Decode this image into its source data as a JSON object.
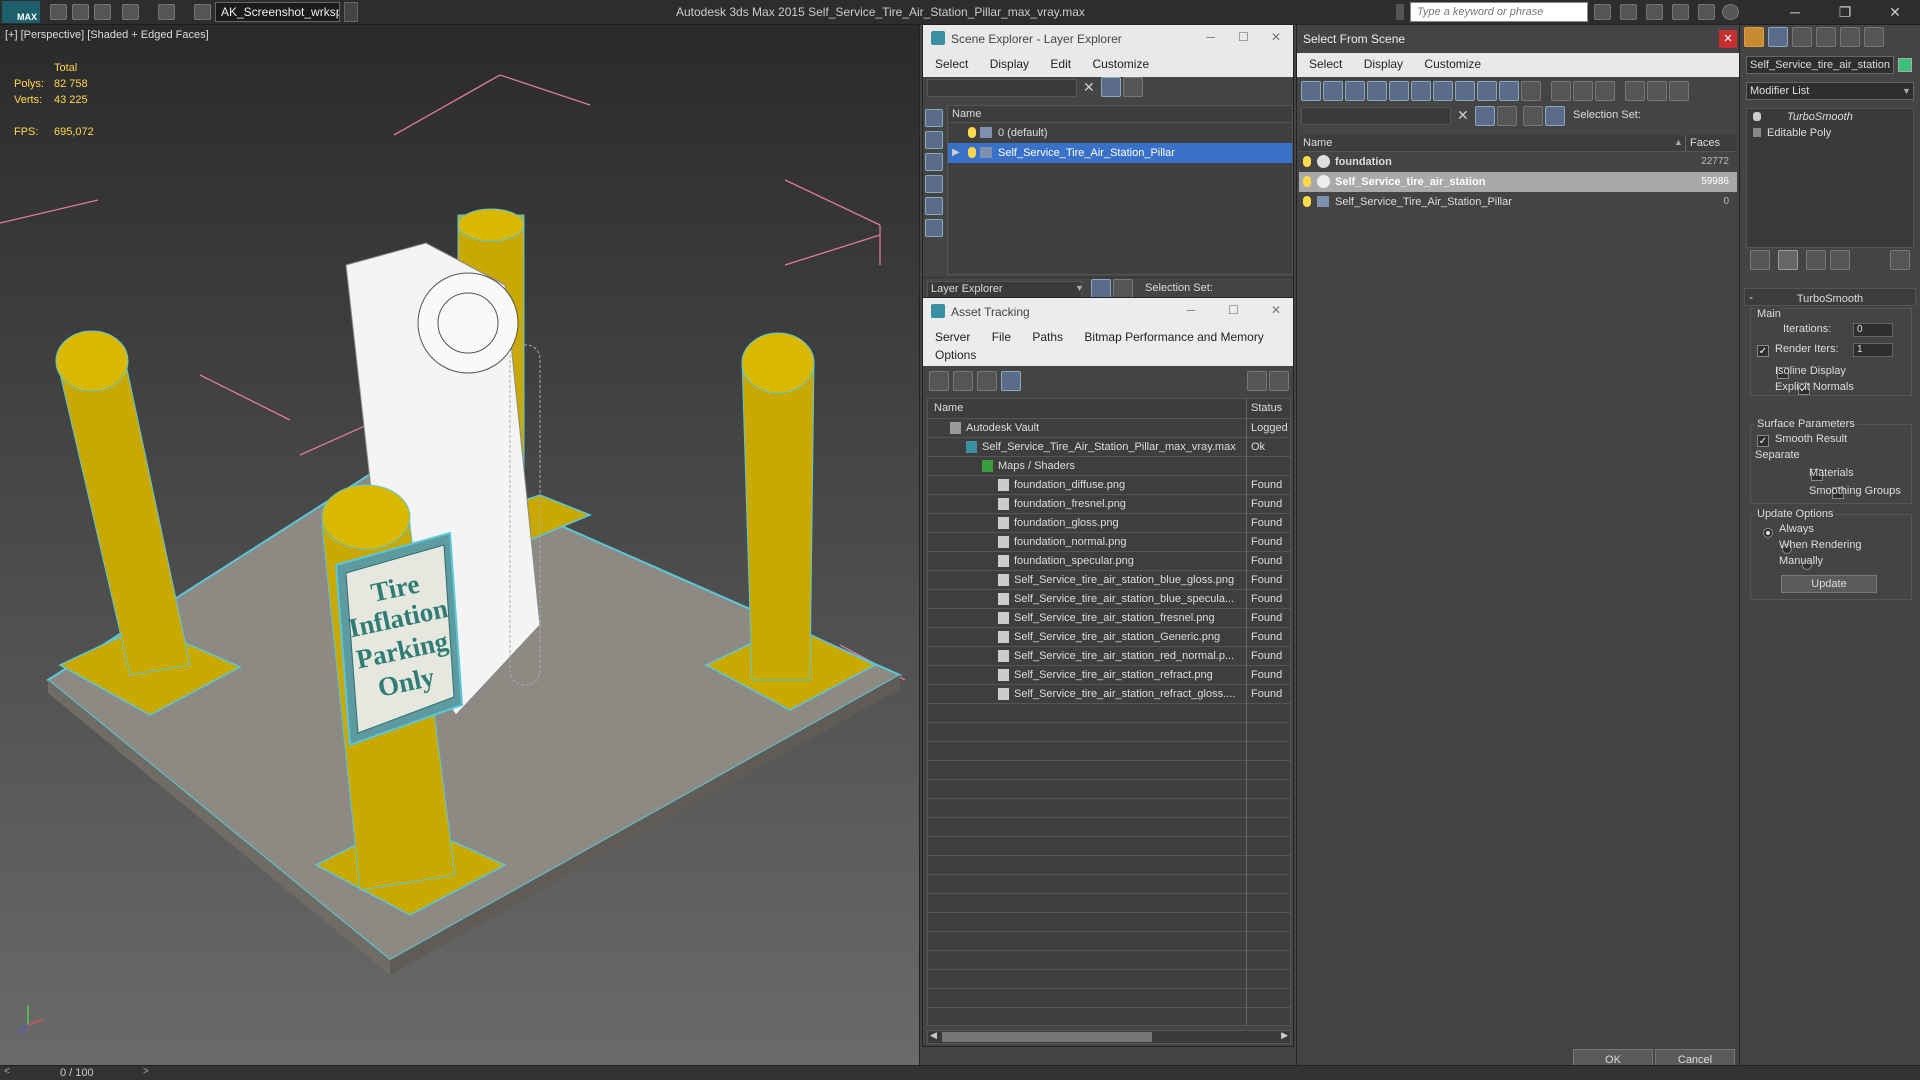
{
  "app": {
    "title": "Autodesk 3ds Max  2015    Self_Service_Tire_Air_Station_Pillar_max_vray.max",
    "logo": "MAX",
    "workspace": "AK_Screenshot_wrksp",
    "search_placeholder": "Type a keyword or phrase"
  },
  "viewport": {
    "label": "[+] [Perspective] [Shaded + Edged Faces]",
    "stats": {
      "total_label": "Total",
      "polys_label": "Polys:",
      "polys": "82 758",
      "verts_label": "Verts:",
      "verts": "43 225",
      "fps_label": "FPS:",
      "fps": "695,072"
    },
    "sign_text": [
      "Tire",
      "Inflation",
      "Parking",
      "Only"
    ]
  },
  "timeline": {
    "label": "0 / 100"
  },
  "scene_explorer": {
    "title": "Scene Explorer - Layer Explorer",
    "menus": [
      "Select",
      "Display",
      "Edit",
      "Customize"
    ],
    "column": "Name",
    "rows": [
      {
        "label": "0 (default)"
      },
      {
        "label": "Self_Service_Tire_Air_Station_Pillar"
      }
    ],
    "footer_dropdown": "Layer Explorer",
    "selection_set_label": "Selection Set:"
  },
  "asset_tracking": {
    "title": "Asset Tracking",
    "menus": [
      "Server",
      "File",
      "Paths",
      "Bitmap Performance and Memory"
    ],
    "menu2": "Options",
    "col_name": "Name",
    "col_status": "Status",
    "rows": [
      {
        "name": "Autodesk Vault",
        "status": "Logged",
        "indent": 0
      },
      {
        "name": "Self_Service_Tire_Air_Station_Pillar_max_vray.max",
        "status": "Ok",
        "indent": 1
      },
      {
        "name": "Maps / Shaders",
        "status": "",
        "indent": 2
      },
      {
        "name": "foundation_diffuse.png",
        "status": "Found",
        "indent": 3
      },
      {
        "name": "foundation_fresnel.png",
        "status": "Found",
        "indent": 3
      },
      {
        "name": "foundation_gloss.png",
        "status": "Found",
        "indent": 3
      },
      {
        "name": "foundation_normal.png",
        "status": "Found",
        "indent": 3
      },
      {
        "name": "foundation_specular.png",
        "status": "Found",
        "indent": 3
      },
      {
        "name": "Self_Service_tire_air_station_blue_gloss.png",
        "status": "Found",
        "indent": 3
      },
      {
        "name": "Self_Service_tire_air_station_blue_specula...",
        "status": "Found",
        "indent": 3
      },
      {
        "name": "Self_Service_tire_air_station_fresnel.png",
        "status": "Found",
        "indent": 3
      },
      {
        "name": "Self_Service_tire_air_station_Generic.png",
        "status": "Found",
        "indent": 3
      },
      {
        "name": "Self_Service_tire_air_station_red_normal.p...",
        "status": "Found",
        "indent": 3
      },
      {
        "name": "Self_Service_tire_air_station_refract.png",
        "status": "Found",
        "indent": 3
      },
      {
        "name": "Self_Service_tire_air_station_refract_gloss....",
        "status": "Found",
        "indent": 3
      }
    ]
  },
  "select_from_scene": {
    "title": "Select From Scene",
    "menus": [
      "Select",
      "Display",
      "Customize"
    ],
    "selection_set_label": "Selection Set:",
    "col_name": "Name",
    "col_faces": "Faces",
    "rows": [
      {
        "name": "foundation",
        "faces": "22772"
      },
      {
        "name": "Self_Service_tire_air_station",
        "faces": "59986"
      },
      {
        "name": "Self_Service_Tire_Air_Station_Pillar",
        "faces": "0"
      }
    ],
    "ok_label": "OK",
    "cancel_label": "Cancel"
  },
  "command_panel": {
    "object_name": "Self_Service_tire_air_station",
    "modifier_list": "Modifier List",
    "stack": [
      "TurboSmooth",
      "Editable Poly"
    ],
    "rollout_title": "TurboSmooth",
    "main_group": "Main",
    "iterations_label": "Iterations:",
    "iterations": "0",
    "render_iters_label": "Render Iters:",
    "render_iters": "1",
    "isoline": "Isoline Display",
    "explicit_normals": "Explicit Normals",
    "surface_params": "Surface Parameters",
    "smooth_result": "Smooth Result",
    "separate": "Separate",
    "materials": "Materials",
    "smoothing_groups": "Smoothing Groups",
    "update_options": "Update Options",
    "always": "Always",
    "when_rendering": "When Rendering",
    "manually": "Manually",
    "update_btn": "Update"
  },
  "colors": {
    "accent": "#3a71c8",
    "highlight_row": "#a9a9a9",
    "stat_yellow": "#ffd84c",
    "pillar": "#c9a800",
    "wire": "#5ac8d8"
  }
}
